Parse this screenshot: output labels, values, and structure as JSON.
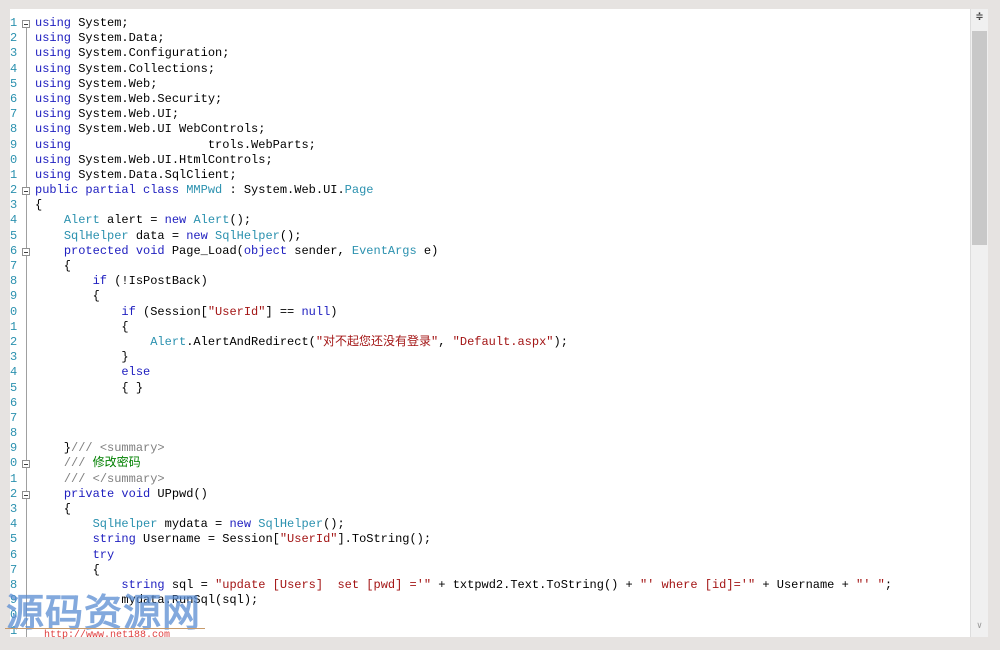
{
  "colors": {
    "keyword": "#2020c0",
    "type": "#2b91af",
    "string": "#a31515",
    "comment": "#008000",
    "xmldoc": "#808080"
  },
  "line_numbers": [
    "1",
    "2",
    "3",
    "4",
    "5",
    "6",
    "7",
    "8",
    "9",
    "0",
    "1",
    "2",
    "3",
    "4",
    "5",
    "6",
    "7",
    "8",
    "9",
    "0",
    "1",
    "2",
    "3",
    "4",
    "5",
    "6",
    "7",
    "8",
    "9",
    "0",
    "1",
    "2",
    "3",
    "4",
    "5",
    "6",
    "7",
    "8",
    "9",
    "0",
    "1"
  ],
  "fold_markers_at_lines": [
    1,
    12,
    16,
    30,
    32
  ],
  "code_lines": [
    [
      [
        "kw",
        "using"
      ],
      [
        "pl",
        " System;"
      ]
    ],
    [
      [
        "kw",
        "using"
      ],
      [
        "pl",
        " System.Data;"
      ]
    ],
    [
      [
        "kw",
        "using"
      ],
      [
        "pl",
        " System.Configuration;"
      ]
    ],
    [
      [
        "kw",
        "using"
      ],
      [
        "pl",
        " System.Collections;"
      ]
    ],
    [
      [
        "kw",
        "using"
      ],
      [
        "pl",
        " System.Web;"
      ]
    ],
    [
      [
        "kw",
        "using"
      ],
      [
        "pl",
        " System.Web.Security;"
      ]
    ],
    [
      [
        "kw",
        "using"
      ],
      [
        "pl",
        " System.Web.UI;"
      ]
    ],
    [
      [
        "kw",
        "using"
      ],
      [
        "pl",
        " System.Web.UI WebControls;"
      ]
    ],
    [
      [
        "kw",
        "using"
      ],
      [
        "pl",
        "                   trols.WebParts;"
      ]
    ],
    [
      [
        "kw",
        "using"
      ],
      [
        "pl",
        " System.Web.UI.HtmlControls;"
      ]
    ],
    [
      [
        "kw",
        "using"
      ],
      [
        "pl",
        " System.Data.SqlClient;"
      ]
    ],
    [
      [
        "kw",
        "public partial class "
      ],
      [
        "ty",
        "MMPwd"
      ],
      [
        "pl",
        " : System.Web.UI."
      ],
      [
        "ty",
        "Page"
      ]
    ],
    [
      [
        "pl",
        "{"
      ]
    ],
    [
      [
        "pl",
        "    "
      ],
      [
        "ty",
        "Alert"
      ],
      [
        "pl",
        " alert = "
      ],
      [
        "kw",
        "new "
      ],
      [
        "ty",
        "Alert"
      ],
      [
        "pl",
        "();"
      ]
    ],
    [
      [
        "pl",
        "    "
      ],
      [
        "ty",
        "SqlHelper"
      ],
      [
        "pl",
        " data = "
      ],
      [
        "kw",
        "new "
      ],
      [
        "ty",
        "SqlHelper"
      ],
      [
        "pl",
        "();"
      ]
    ],
    [
      [
        "pl",
        "    "
      ],
      [
        "kw",
        "protected void"
      ],
      [
        "pl",
        " Page_Load("
      ],
      [
        "kw",
        "object"
      ],
      [
        "pl",
        " sender, "
      ],
      [
        "ty",
        "EventArgs"
      ],
      [
        "pl",
        " e)"
      ]
    ],
    [
      [
        "pl",
        "    {"
      ]
    ],
    [
      [
        "pl",
        "        "
      ],
      [
        "kw",
        "if"
      ],
      [
        "pl",
        " (!IsPostBack)"
      ]
    ],
    [
      [
        "pl",
        "        {"
      ]
    ],
    [
      [
        "pl",
        "            "
      ],
      [
        "kw",
        "if"
      ],
      [
        "pl",
        " (Session["
      ],
      [
        "st",
        "\"UserId\""
      ],
      [
        "pl",
        "] == "
      ],
      [
        "kw",
        "null"
      ],
      [
        "pl",
        ")"
      ]
    ],
    [
      [
        "pl",
        "            {"
      ]
    ],
    [
      [
        "pl",
        "                "
      ],
      [
        "ty",
        "Alert"
      ],
      [
        "pl",
        ".AlertAndRedirect("
      ],
      [
        "st",
        "\"对不起您还没有登录\""
      ],
      [
        "pl",
        ", "
      ],
      [
        "st",
        "\"Default.aspx\""
      ],
      [
        "pl",
        ");"
      ]
    ],
    [
      [
        "pl",
        "            }"
      ]
    ],
    [
      [
        "pl",
        "            "
      ],
      [
        "kw",
        "else"
      ]
    ],
    [
      [
        "pl",
        "            { }"
      ]
    ],
    [],
    [],
    [],
    [
      [
        "pl",
        "    }"
      ],
      [
        "xd",
        "/// <summary>"
      ]
    ],
    [
      [
        "pl",
        "    "
      ],
      [
        "xd",
        "/// "
      ],
      [
        "cm",
        "修改密码"
      ]
    ],
    [
      [
        "pl",
        "    "
      ],
      [
        "xd",
        "/// </summary>"
      ]
    ],
    [
      [
        "pl",
        "    "
      ],
      [
        "kw",
        "private void"
      ],
      [
        "pl",
        " UPpwd()"
      ]
    ],
    [
      [
        "pl",
        "    {"
      ]
    ],
    [
      [
        "pl",
        "        "
      ],
      [
        "ty",
        "SqlHelper"
      ],
      [
        "pl",
        " mydata = "
      ],
      [
        "kw",
        "new "
      ],
      [
        "ty",
        "SqlHelper"
      ],
      [
        "pl",
        "();"
      ]
    ],
    [
      [
        "pl",
        "        "
      ],
      [
        "kw",
        "string"
      ],
      [
        "pl",
        " Username = Session["
      ],
      [
        "st",
        "\"UserId\""
      ],
      [
        "pl",
        "].ToString();"
      ]
    ],
    [
      [
        "pl",
        "        "
      ],
      [
        "kw",
        "try"
      ]
    ],
    [
      [
        "pl",
        "        {"
      ]
    ],
    [
      [
        "pl",
        "            "
      ],
      [
        "kw",
        "string"
      ],
      [
        "pl",
        " sql = "
      ],
      [
        "st",
        "\"update [Users]  set [pwd] ='\""
      ],
      [
        "pl",
        " + txtpwd2.Text.ToString() + "
      ],
      [
        "st",
        "\"' where [id]='\""
      ],
      [
        "pl",
        " + Username + "
      ],
      [
        "st",
        "\"' \""
      ],
      [
        "pl",
        ";"
      ]
    ],
    [
      [
        "pl",
        "            mydata.RunSql(sql);"
      ]
    ],
    [],
    []
  ],
  "watermark": {
    "text": "源码资源网",
    "url": "http://www.net188.com"
  }
}
